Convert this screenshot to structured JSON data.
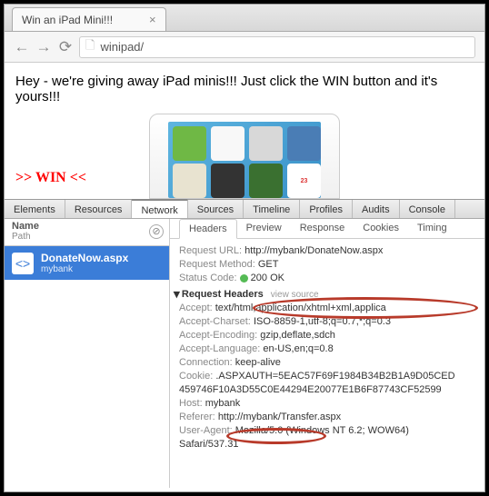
{
  "tab": {
    "title": "Win an iPad Mini!!!",
    "close": "×"
  },
  "nav": {
    "back": "←",
    "fwd": "→",
    "reload": "⟳",
    "page": "🗋",
    "url": "winipad/"
  },
  "page": {
    "headline": "Hey - we're giving away iPad minis!!! Just click the WIN button and it's yours!!!",
    "win": ">> WIN <<",
    "cal": "23"
  },
  "dev": {
    "tabs": [
      "Elements",
      "Resources",
      "Network",
      "Sources",
      "Timeline",
      "Profiles",
      "Audits",
      "Console"
    ],
    "left": {
      "h1": "Name",
      "h2": "Path",
      "clear": "⊘",
      "req_name": "DonateNow.aspx",
      "req_path": "mybank",
      "ico": "<>"
    },
    "subtabs": [
      "Headers",
      "Preview",
      "Response",
      "Cookies",
      "Timing"
    ],
    "d": {
      "url_k": "Request URL:",
      "url_v": "http://mybank/DonateNow.aspx",
      "method_k": "Request Method:",
      "method_v": "GET",
      "status_k": "Status Code:",
      "status_v": "200 OK",
      "rh": "Request Headers",
      "vs": "view source",
      "accept_k": "Accept:",
      "accept_v": "text/html,application/xhtml+xml,applica",
      "ac_k": "Accept-Charset:",
      "ac_v": "ISO-8859-1,utf-8;q=0.7,*;q=0.3",
      "ae_k": "Accept-Encoding:",
      "ae_v": "gzip,deflate,sdch",
      "al_k": "Accept-Language:",
      "al_v": "en-US,en;q=0.8",
      "conn_k": "Connection:",
      "conn_v": "keep-alive",
      "cookie_k": "Cookie:",
      "cookie_v": ".ASPXAUTH=5EAC57F69F1984B34B2B1A9D05CED",
      "cookie_v2": "459746F10A3D55C0E44294E20077E1B6F87743CF52599",
      "host_k": "Host:",
      "host_v": "mybank",
      "ref_k": "Referer:",
      "ref_v": "http://mybank/Transfer.aspx",
      "ua_k": "User-Agent:",
      "ua_v": "Mozilla/5.0 (Windows NT 6.2; WOW64)",
      "ua_v2": "Safari/537.31"
    }
  }
}
